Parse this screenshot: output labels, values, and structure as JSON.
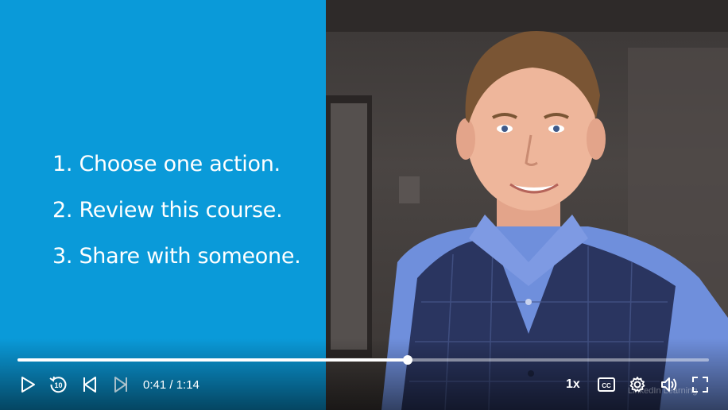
{
  "slide": {
    "items": [
      "1. Choose one action.",
      "2. Review this course.",
      "3. Share with someone."
    ],
    "background_color": "#0a9ad9"
  },
  "player": {
    "progress_fraction": 0.564,
    "current_time": "0:41",
    "duration": "1:14",
    "time_display": "0:41 / 1:14",
    "speed_label": "1x",
    "watermark": "LinkedIn Learning"
  },
  "controls": {
    "icons": [
      "play-icon",
      "rewind-10-icon",
      "previous-icon",
      "next-icon",
      "captions-icon",
      "settings-icon",
      "volume-icon",
      "fullscreen-icon"
    ]
  }
}
